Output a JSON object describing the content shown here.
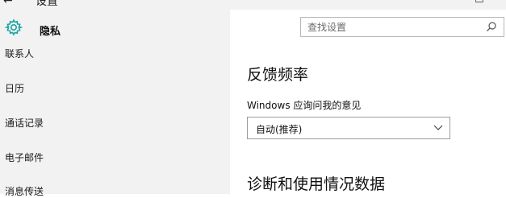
{
  "window": {
    "back_glyph": "←",
    "title": "设置",
    "min_glyph": "—",
    "max_glyph": "☐"
  },
  "header": {
    "section_title": "隐私",
    "section_icon": "gear-icon",
    "search_placeholder": "查找设置",
    "search_icon": "search-icon",
    "accent_color": "#1aa3a3"
  },
  "sidebar": {
    "items": [
      {
        "label": "联系人"
      },
      {
        "label": "日历"
      },
      {
        "label": "通话记录"
      },
      {
        "label": "电子邮件"
      },
      {
        "label": "消息传送"
      }
    ]
  },
  "main": {
    "feedback_heading": "反馈频率",
    "feedback_label": "Windows 应询问我的意见",
    "feedback_select_value": "自动(推荐)",
    "diagnostics_heading": "诊断和使用情况数据"
  }
}
